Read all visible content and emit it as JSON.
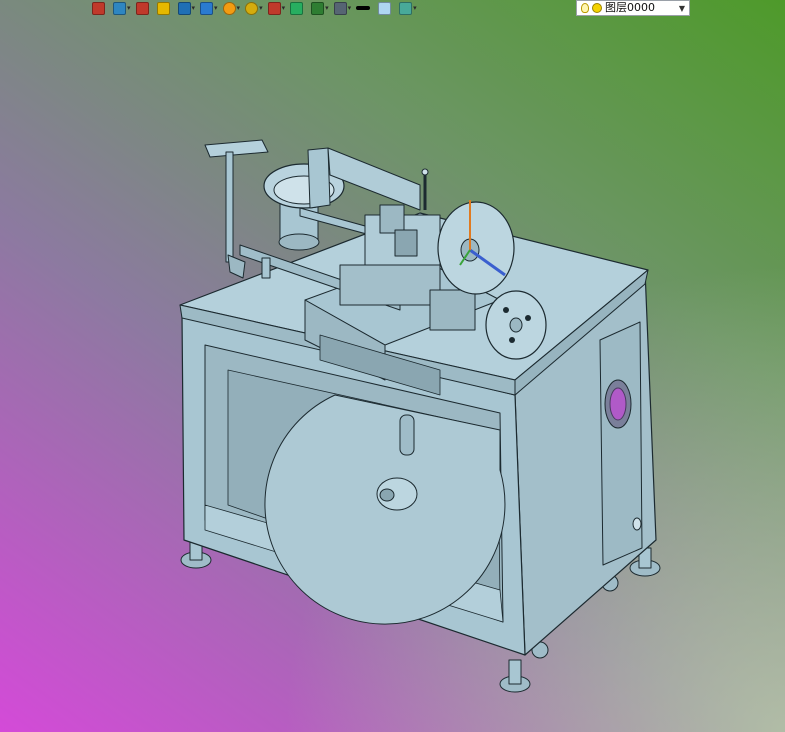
{
  "toolbar": {
    "buttons": [
      {
        "icon": "new-view-icon",
        "color": "#c0392b",
        "dropdown": false
      },
      {
        "icon": "light-bulb-icon",
        "color": "#2e86c1",
        "dropdown": true
      },
      {
        "icon": "pencil-icon",
        "color": "#c0392b",
        "dropdown": false
      },
      {
        "icon": "box-yellow-icon",
        "color": "#e6b800",
        "dropdown": false
      },
      {
        "icon": "cube-icon",
        "color": "#1f6fb5",
        "dropdown": true
      },
      {
        "icon": "cube-shaded-icon",
        "color": "#2a7bd0",
        "dropdown": true
      },
      {
        "icon": "color-wheel-icon",
        "color": "#f39c12",
        "dropdown": true
      },
      {
        "icon": "magnifier-icon",
        "color": "#d4ac0d",
        "dropdown": true
      },
      {
        "icon": "section-plane-icon",
        "color": "#c0392b",
        "dropdown": true
      },
      {
        "icon": "frame-icon",
        "color": "#27ae60",
        "dropdown": false
      },
      {
        "icon": "color-swatch-icon",
        "color": "#2e7d32",
        "dropdown": true
      },
      {
        "icon": "display-mode-icon",
        "color": "#566573",
        "dropdown": true
      },
      {
        "icon": "line-weight-icon",
        "color": "#000000",
        "dropdown": false
      },
      {
        "icon": "fill-color-icon",
        "color": "#aed6f1",
        "dropdown": false
      },
      {
        "icon": "layer-stack-icon",
        "color": "#48a999",
        "dropdown": true
      }
    ],
    "layer": {
      "value": "图层0000"
    }
  },
  "viewport": {
    "background_top_right": "#4e9a2a",
    "background_bottom_left": "#d44ad8",
    "model_color": "#a8c6d2"
  }
}
